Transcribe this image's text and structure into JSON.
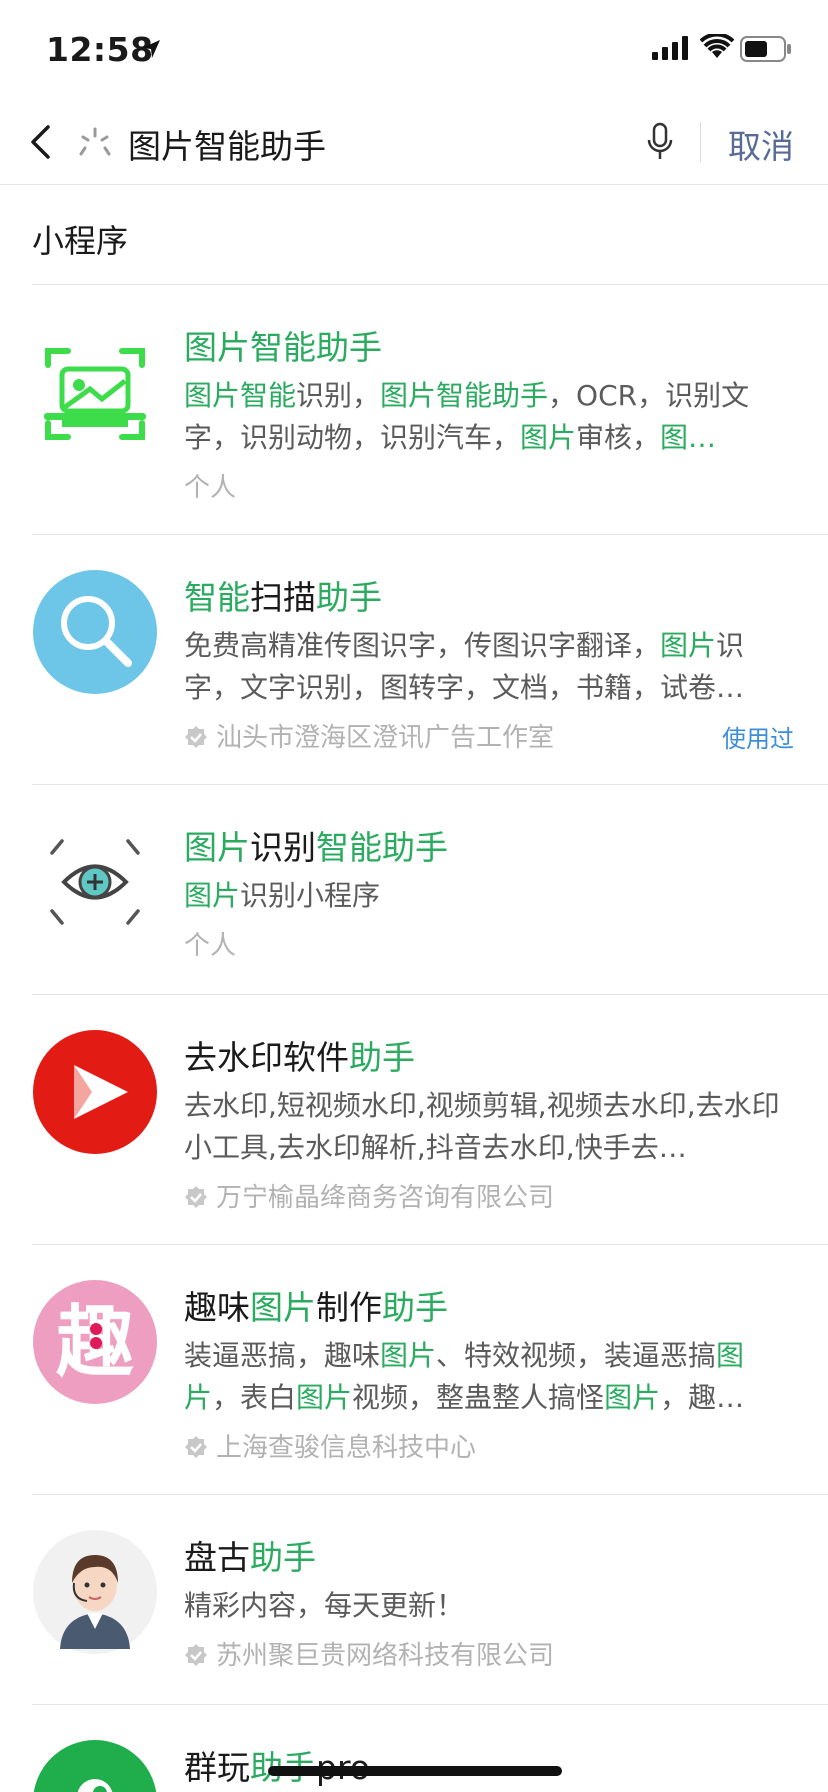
{
  "status": {
    "time": "12:58"
  },
  "search": {
    "query": "图片智能助手",
    "cancel": "取消"
  },
  "section": "小程序",
  "items": [
    {
      "title": [
        {
          "t": "图片智能助手",
          "h": true
        }
      ],
      "desc": [
        {
          "t": "图片智能",
          "h": true
        },
        {
          "t": "识别，",
          "h": false
        },
        {
          "t": "图片智能助手",
          "h": true
        },
        {
          "t": "，OCR，识别文字，识别动物，识别汽车，",
          "h": false
        },
        {
          "t": "图片",
          "h": true
        },
        {
          "t": "审核，",
          "h": false
        },
        {
          "t": "图…",
          "h": true
        }
      ],
      "owner": "个人",
      "verified": false,
      "used": "",
      "icon": "scan-frame-icon"
    },
    {
      "title": [
        {
          "t": "智能",
          "h": true
        },
        {
          "t": "扫描",
          "h": false
        },
        {
          "t": "助手",
          "h": true
        }
      ],
      "desc": [
        {
          "t": "免费高精准传图识字，传图识字翻译，",
          "h": false
        },
        {
          "t": "图片",
          "h": true
        },
        {
          "t": "识字，文字识别，图转字，文档，书籍，试卷…",
          "h": false
        }
      ],
      "owner": "汕头市澄海区澄讯广告工作室",
      "verified": true,
      "used": "使用过",
      "icon": "magnifier-icon"
    },
    {
      "title": [
        {
          "t": "图片",
          "h": true
        },
        {
          "t": "识别",
          "h": false
        },
        {
          "t": "智能助手",
          "h": true
        }
      ],
      "desc": [
        {
          "t": "图片",
          "h": true
        },
        {
          "t": "识别小程序",
          "h": false
        }
      ],
      "owner": "个人",
      "verified": false,
      "used": "",
      "icon": "eye-icon"
    },
    {
      "title": [
        {
          "t": "去水印软件",
          "h": false
        },
        {
          "t": "助手",
          "h": true
        }
      ],
      "desc": [
        {
          "t": "去水印,短视频水印,视频剪辑,视频去水印,去水印小工具,去水印解析,抖音去水印,快手去…",
          "h": false
        }
      ],
      "owner": "万宁榆晶绛商务咨询有限公司",
      "verified": true,
      "used": "",
      "icon": "play-icon"
    },
    {
      "title": [
        {
          "t": "趣味",
          "h": false
        },
        {
          "t": "图片",
          "h": true
        },
        {
          "t": "制作",
          "h": false
        },
        {
          "t": "助手",
          "h": true
        }
      ],
      "desc": [
        {
          "t": "装逼恶搞，趣味",
          "h": false
        },
        {
          "t": "图片",
          "h": true
        },
        {
          "t": "、特效视频，装逼恶搞",
          "h": false
        },
        {
          "t": "图片",
          "h": true
        },
        {
          "t": "，表白",
          "h": false
        },
        {
          "t": "图片",
          "h": true
        },
        {
          "t": "视频，整蛊整人搞怪",
          "h": false
        },
        {
          "t": "图片",
          "h": true
        },
        {
          "t": "，趣…",
          "h": false
        }
      ],
      "owner": "上海查骏信息科技中心",
      "verified": true,
      "used": "",
      "icon": "qu-char-icon",
      "icon_text": "趣"
    },
    {
      "title": [
        {
          "t": "盘古",
          "h": false
        },
        {
          "t": "助手",
          "h": true
        }
      ],
      "desc": [
        {
          "t": "精彩内容，每天更新！",
          "h": false
        }
      ],
      "owner": "苏州聚巨贵网络科技有限公司",
      "verified": true,
      "used": "",
      "icon": "assistant-avatar-icon"
    },
    {
      "title": [
        {
          "t": "群玩",
          "h": false
        },
        {
          "t": "助手",
          "h": true
        },
        {
          "t": "pro",
          "h": false
        }
      ],
      "desc": [],
      "owner": "",
      "verified": false,
      "used": "",
      "icon": "green-logo-icon"
    }
  ],
  "colors": {
    "highlight": "#2aab5f",
    "cancel": "#576b95",
    "used": "#3d8ed8"
  }
}
